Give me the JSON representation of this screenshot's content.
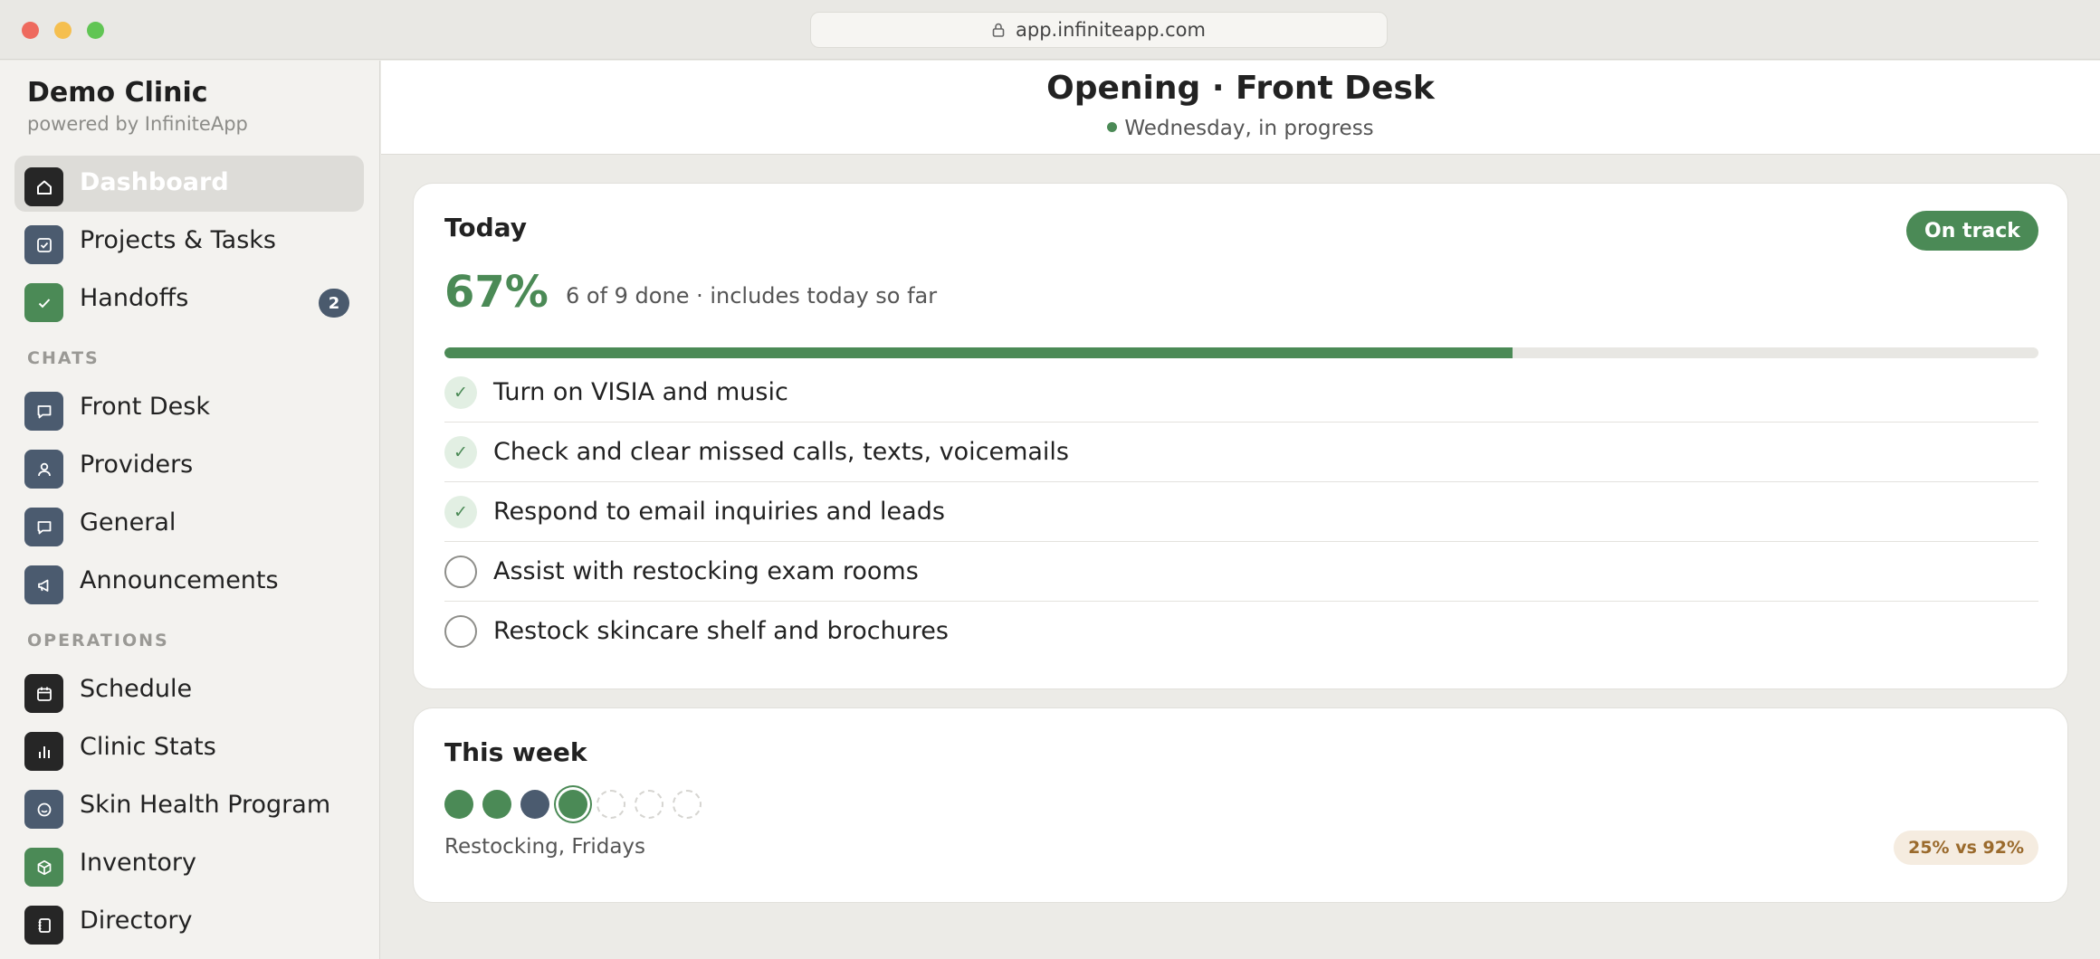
{
  "browser": {
    "url": "app.infiniteapp.com"
  },
  "sidebar": {
    "brand_title": "Demo Clinic",
    "brand_subtitle": "powered by InfiniteApp",
    "items": [
      {
        "label": "Dashboard",
        "icon": "home-icon",
        "active": true
      },
      {
        "label": "Projects & Tasks",
        "icon": "checkbox-icon"
      },
      {
        "label": "Handoffs",
        "icon": "check-icon",
        "badge": "2"
      }
    ],
    "chats_title": "CHATS",
    "chats": [
      {
        "label": "Front Desk",
        "icon": "chat-bubble-icon"
      },
      {
        "label": "Providers",
        "icon": "person-icon"
      },
      {
        "label": "General",
        "icon": "chat-bubble-icon"
      },
      {
        "label": "Announcements",
        "icon": "megaphone-icon"
      }
    ],
    "operations_title": "OPERATIONS",
    "operations": [
      {
        "label": "Schedule",
        "icon": "calendar-icon"
      },
      {
        "label": "Clinic Stats",
        "icon": "bar-chart-icon"
      },
      {
        "label": "Skin Health Program",
        "icon": "smile-icon"
      },
      {
        "label": "Inventory",
        "icon": "box-icon"
      },
      {
        "label": "Directory",
        "icon": "address-book-icon"
      }
    ]
  },
  "header": {
    "title": "Opening · Front Desk",
    "subtitle": "Wednesday, in progress"
  },
  "today": {
    "title": "Today",
    "status": "On track",
    "percent": "67%",
    "progress_fraction": 0.67,
    "detail": "6 of 9 done · includes today so far",
    "tasks": [
      {
        "label": "Turn on VISIA and music",
        "done": true
      },
      {
        "label": "Check and clear missed calls, texts, voicemails",
        "done": true
      },
      {
        "label": "Respond to email inquiries and leads",
        "done": true
      },
      {
        "label": "Assist with restocking exam rooms",
        "done": false
      },
      {
        "label": "Restock skincare shelf and brochures",
        "done": false
      }
    ]
  },
  "week": {
    "title": "This week",
    "days": [
      "complete",
      "complete",
      "partial",
      "today",
      "upcoming",
      "upcoming",
      "upcoming"
    ],
    "caption": "Restocking, Fridays",
    "comparison": "25% vs 92%"
  },
  "colors": {
    "accent_green": "#4b8a56",
    "slate": "#4b5b6f",
    "dark": "#262626",
    "amber_text": "#9a6a2c"
  }
}
